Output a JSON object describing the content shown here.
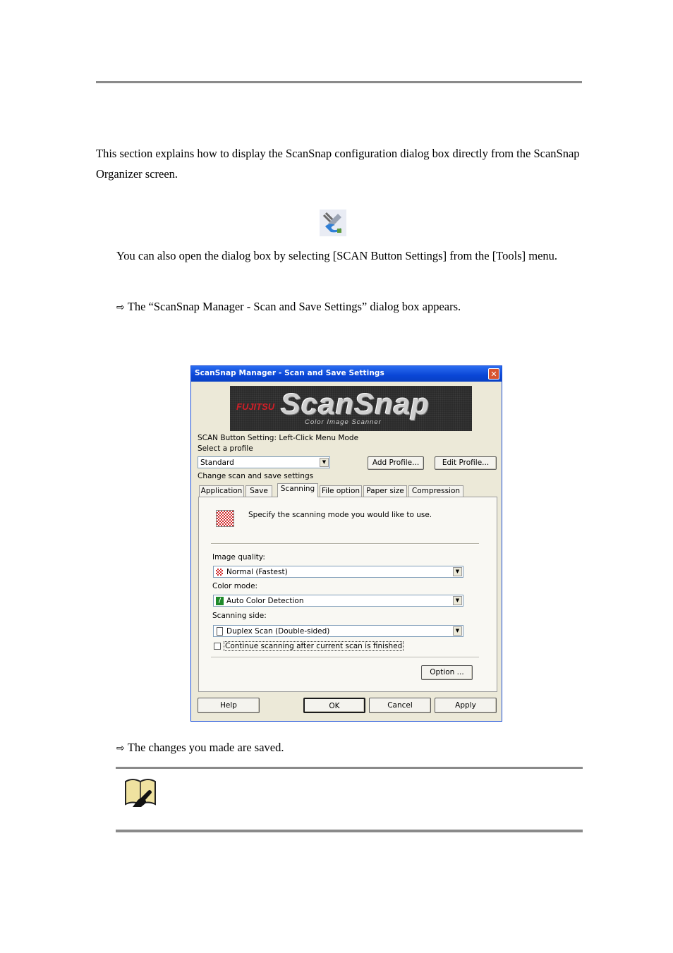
{
  "doc": {
    "intro": "This section explains how to display the ScanSnap configuration dialog box directly from the ScanSnap Organizer screen.",
    "step_note": "You can also open the dialog box by selecting [SCAN Button Settings] from the [Tools] menu.",
    "result_1": "The “ScanSnap Manager - Scan and Save Settings” dialog box appears.",
    "result_2": "The changes you made are saved.",
    "arrow_icon": "hollow-right-arrow"
  },
  "dialog": {
    "title": "ScanSnap Manager - Scan and Save Settings",
    "banner": {
      "maker": "FUJITSU",
      "product": "ScanSnap",
      "tagline": "Color Image Scanner"
    },
    "mode_label": "SCAN Button Setting: Left-Click Menu Mode",
    "profile_label": "Select a profile",
    "profile_value": "Standard",
    "add_profile": "Add Profile...",
    "edit_profile": "Edit Profile...",
    "change_label": "Change scan and save settings",
    "tabs": [
      "Application",
      "Save",
      "Scanning",
      "File option",
      "Paper size",
      "Compression"
    ],
    "active_tab": "Scanning",
    "panel": {
      "description": "Specify the scanning mode you would like to use.",
      "image_quality_label": "Image quality:",
      "image_quality_value": "Normal (Fastest)",
      "color_mode_label": "Color mode:",
      "color_mode_value": "Auto Color Detection",
      "scanning_side_label": "Scanning side:",
      "scanning_side_value": "Duplex Scan (Double-sided)",
      "continue_label": "Continue scanning after current scan is finished",
      "continue_checked": false,
      "option_button": "Option ..."
    },
    "buttons": {
      "help": "Help",
      "ok": "OK",
      "cancel": "Cancel",
      "apply": "Apply"
    }
  }
}
